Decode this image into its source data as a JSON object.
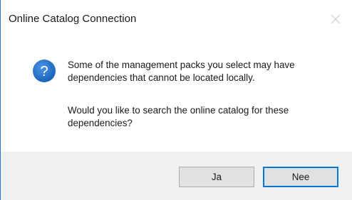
{
  "window": {
    "title": "Online Catalog Connection",
    "close_icon": "close-icon"
  },
  "message": {
    "icon": "question-icon",
    "icon_glyph": "?",
    "line1": "Some of the management packs you select may have dependencies that cannot be located locally.",
    "line2": "Would you like to search the online catalog for these dependencies?"
  },
  "buttons": {
    "yes_label": "Ja",
    "no_label": "Nee"
  },
  "colors": {
    "accent": "#0078d7",
    "icon_blue": "#1f6fc5",
    "footer_bg": "#f0f0f0"
  }
}
